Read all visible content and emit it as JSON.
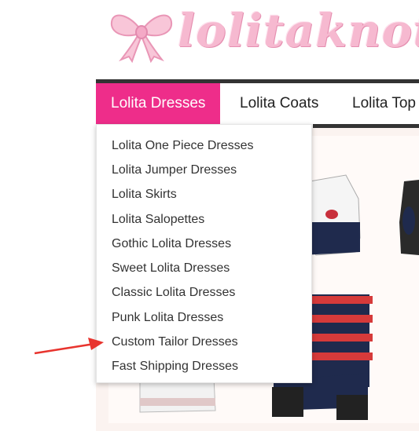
{
  "logo": {
    "text": "lolitaknot"
  },
  "nav": {
    "items": [
      {
        "label": "Lolita Dresses"
      },
      {
        "label": "Lolita Coats"
      },
      {
        "label": "Lolita Top"
      }
    ]
  },
  "dropdown": {
    "items": [
      {
        "label": "Lolita One Piece Dresses"
      },
      {
        "label": "Lolita Jumper Dresses"
      },
      {
        "label": "Lolita Skirts"
      },
      {
        "label": "Lolita Salopettes"
      },
      {
        "label": "Gothic Lolita Dresses"
      },
      {
        "label": "Sweet Lolita Dresses"
      },
      {
        "label": "Classic Lolita Dresses"
      },
      {
        "label": "Punk Lolita Dresses"
      },
      {
        "label": "Custom Tailor Dresses"
      },
      {
        "label": "Fast Shipping Dresses"
      }
    ]
  },
  "colors": {
    "accent": "#ee2d8a",
    "annotation_arrow": "#e8342e"
  }
}
